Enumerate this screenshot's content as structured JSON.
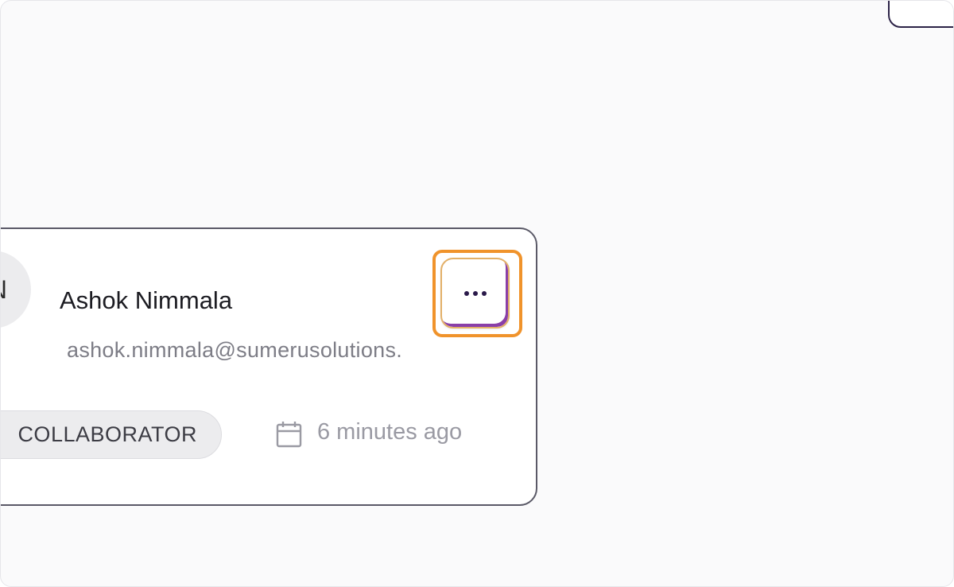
{
  "user_card": {
    "avatar_initial": "N",
    "name": "Ashok Nimmala",
    "email": "ashok.nimmala@sumerusolutions.",
    "role": "COLLABORATOR",
    "timestamp": "6 minutes ago",
    "more_icon": "more-horizontal-icon",
    "calendar_icon": "calendar-icon"
  },
  "colors": {
    "highlight": "#f0932b",
    "card_border": "#5a5967",
    "muted_text": "#9a9aa3"
  }
}
